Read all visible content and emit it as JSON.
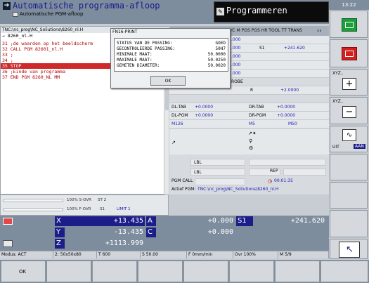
{
  "header": {
    "mode_title": "Automatische programma-afloop",
    "mode_subtitle": "Automatische PGM-afloop",
    "prog_title": "Programmeren",
    "clock": "13:22"
  },
  "program": {
    "path": "TNC:\\nc_prog\\NC_Soliutions\\8260_nl.H",
    "pgm_line": "→ 8260_nl.H",
    "lines": [
      "31 ;de waarden op het beeldscherm",
      "32 CALL PGM 82601_nl.H",
      "33 ;",
      "34 ;",
      "35 STOP",
      "36 ;Einde van programma",
      "37 END PGM 8260_NL MM"
    ]
  },
  "popup": {
    "title": "FN16-PRINT",
    "rows": [
      {
        "label": "STATUS VAN DE PASSING:",
        "value": "GOED"
      },
      {
        "label": "GECONTROLEERDE PASSING:",
        "value": "50H7"
      },
      {
        "label": "MINIMALE MAAT:",
        "value": "50.0000"
      },
      {
        "label": "MAXIMALE MAAT:",
        "value": "50.0250"
      },
      {
        "label": "GEMETEN DIAMETER:",
        "value": "50.0020"
      }
    ],
    "ok": "OK"
  },
  "status_tabs": "CYC M POS POS HR TOOL TT TRANS",
  "status": {
    "v1": ".000",
    "s1": "S1",
    "s1val": "+241.620",
    "v2": ".000",
    "v3": ".000",
    "v4": ".000",
    "v5": ".000",
    "robe": "ROBE",
    "r": "R",
    "rval": "+2.0000",
    "dltab": "DL-TAB",
    "dltabv": "+0.0000",
    "drtab": "DR-TAB",
    "drtabv": "+0.0000",
    "dlpgm": "DL-PGM",
    "dlpgmv": "+0.0000",
    "drpgm": "DR-PGM",
    "drpgmv": "+0.0000",
    "m126": "M126",
    "m5": "M5",
    "m50": "M50",
    "lbl1": "LBL",
    "lbl2": "LBL",
    "rep": "REP",
    "pgmcall": "PGM CALL",
    "time": "00:01:35",
    "actief": "Actief PGM:",
    "actief_path": "TNC:\\nc_prog\\NC_Soliutions\\8260_nl.H"
  },
  "override": {
    "s_ovr": "100% S-OVR",
    "f_ovr": "100% F-OVR",
    "st": "ST 2",
    "s1": "S1",
    "limit": "LIMIT 1"
  },
  "positions": {
    "x_lbl": "X",
    "x_val": "+13.435",
    "y_lbl": "Y",
    "y_val": "-13.435",
    "z_lbl": "Z",
    "z_val": "+1113.999",
    "a_lbl": "A",
    "a_val": "+0.000",
    "c_lbl": "C",
    "c_val": "+0.000",
    "s1_lbl": "S1",
    "s1_val": "+241.620"
  },
  "modus": {
    "modus": "Modus: ACT",
    "tool": "2: 50x50x80",
    "t": "T 600",
    "s": "S 50.00",
    "f": "F 0mm/min",
    "ovr": "Ovr 100%",
    "m": "M 5/9"
  },
  "softkeys": {
    "ok": "OK",
    "xyz1": "XYZ..",
    "xyz2": "XYZ..",
    "uit": "UIT",
    "aan": "AAN"
  },
  "colors": {
    "accent": "#1d1d8a",
    "stop_red": "#cf2a2a",
    "green_key": "#1b9e3b",
    "red_key": "#d02020"
  }
}
